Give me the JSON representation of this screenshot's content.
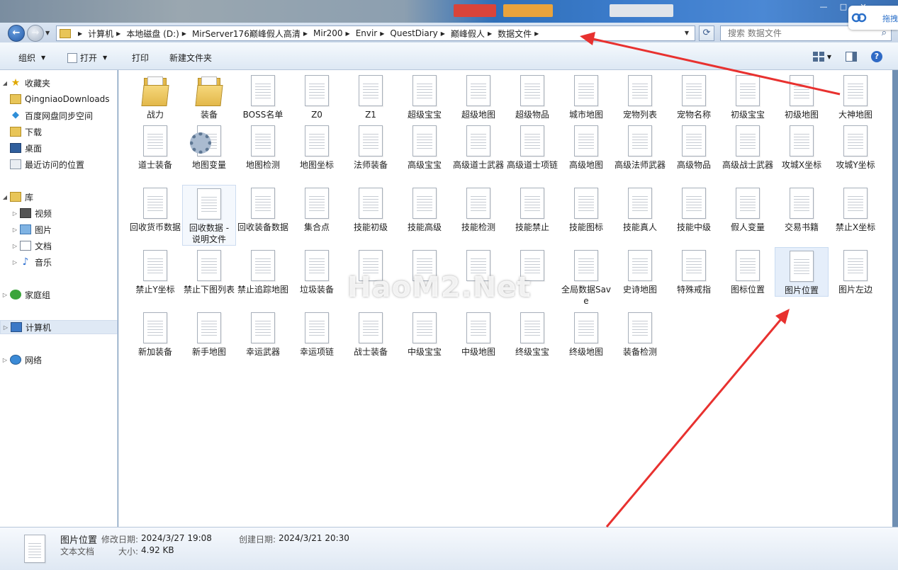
{
  "window": {
    "minimize": "—",
    "maximize": "□",
    "close": "✕",
    "widget_label": "拖拽"
  },
  "address": {
    "crumbs": [
      "计算机",
      "本地磁盘 (D:)",
      "MirServer176巅峰假人高清",
      "Mir200",
      "Envir",
      "QuestDiary",
      "巅峰假人",
      "数据文件"
    ],
    "search_placeholder": "搜索 数据文件"
  },
  "toolbar": {
    "organize": "组织",
    "open": "打开",
    "print": "打印",
    "new_folder": "新建文件夹"
  },
  "sidebar": {
    "favorites": "收藏夹",
    "fav_items": [
      "QingniaoDownloads",
      "百度网盘同步空间",
      "下载",
      "桌面",
      "最近访问的位置"
    ],
    "library": "库",
    "lib_items": [
      "视频",
      "图片",
      "文档",
      "音乐"
    ],
    "homegroup": "家庭组",
    "computer": "计算机",
    "network": "网络"
  },
  "files": {
    "row1": [
      "战力",
      "装备",
      "BOSS名单",
      "Z0",
      "Z1",
      "超级宝宝",
      "超级地图",
      "超级物品",
      "城市地图",
      "宠物列表",
      "宠物名称",
      "初级宝宝",
      "初级地图",
      "大神地图"
    ],
    "row2": [
      "道士装备",
      "地图变量",
      "地图检测",
      "地图坐标",
      "法师装备",
      "高级宝宝",
      "高级道士武器",
      "高级道士项链",
      "高级地图",
      "高级法师武器",
      "高级物品",
      "高级战士武器",
      "攻城X坐标",
      "攻城Y坐标"
    ],
    "row3": [
      "回收货币数据",
      "回收数据 - 说明文件",
      "回收装备数据",
      "集合点",
      "技能初级",
      "技能高级",
      "技能检测",
      "技能禁止",
      "技能图标",
      "技能真人",
      "技能中级",
      "假人变量",
      "交易书籍",
      "禁止X坐标"
    ],
    "row4": [
      "禁止Y坐标",
      "禁止下图列表",
      "禁止追踪地图",
      "垃圾装备",
      "",
      "",
      "",
      "",
      "全局数据Save",
      "史诗地图",
      "特殊戒指",
      "图标位置",
      "图片位置",
      "图片左边"
    ],
    "row5": [
      "新加装备",
      "新手地图",
      "幸运武器",
      "幸运项链",
      "战士装备",
      "中级宝宝",
      "中级地图",
      "终级宝宝",
      "终级地图",
      "装备检测"
    ]
  },
  "watermark": "HaoM2.Net",
  "details": {
    "name": "图片位置",
    "type": "文本文档",
    "modified_label": "修改日期:",
    "modified": "2024/3/27 19:08",
    "created_label": "创建日期:",
    "created": "2024/3/21 20:30",
    "size_label": "大小:",
    "size": "4.92 KB"
  },
  "colors": {
    "arrow": "#e8312f",
    "selection": "#e5eefa"
  }
}
